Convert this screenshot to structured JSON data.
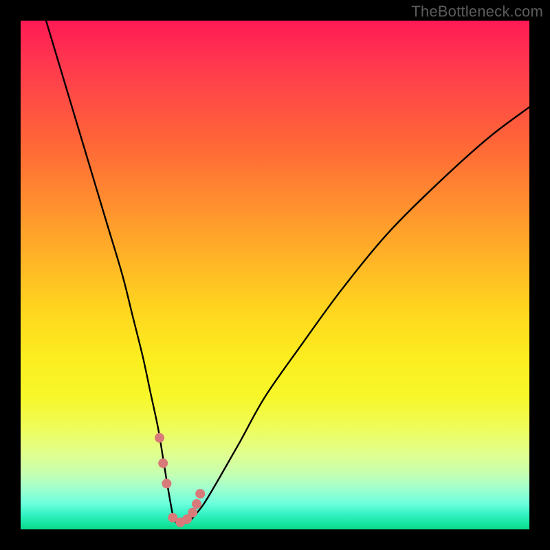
{
  "watermark": "TheBottleneck.com",
  "chart_data": {
    "type": "line",
    "title": "",
    "xlabel": "",
    "ylabel": "",
    "xlim": [
      0,
      100
    ],
    "ylim": [
      0,
      100
    ],
    "curve": {
      "x": [
        5,
        8,
        11,
        14,
        17,
        20,
        22,
        24,
        25.5,
        27,
        28,
        28.8,
        29.5,
        30,
        30.5,
        31,
        32,
        33,
        34,
        36,
        39,
        43,
        48,
        55,
        63,
        72,
        82,
        92,
        100
      ],
      "y": [
        100,
        90,
        80,
        70,
        60,
        50,
        42,
        34,
        27,
        20,
        14,
        9,
        5,
        2.5,
        1.4,
        1.2,
        1.2,
        1.5,
        2.5,
        5,
        10,
        17,
        26,
        36,
        47,
        58,
        68,
        77,
        83
      ]
    },
    "markers": {
      "x": [
        27.3,
        28.0,
        28.7,
        29.9,
        31.4,
        32.7,
        33.8,
        34.6,
        35.3
      ],
      "y": [
        18.0,
        13.0,
        9.0,
        2.3,
        1.4,
        2.0,
        3.3,
        5.0,
        7.0
      ],
      "color": "#d97a7a",
      "radius": 7
    },
    "gradient_stops": [
      {
        "pos": 0.0,
        "color": "#ff1a55"
      },
      {
        "pos": 0.1,
        "color": "#ff3d4d"
      },
      {
        "pos": 0.24,
        "color": "#ff6637"
      },
      {
        "pos": 0.36,
        "color": "#ff8f2f"
      },
      {
        "pos": 0.46,
        "color": "#ffb127"
      },
      {
        "pos": 0.56,
        "color": "#ffd31f"
      },
      {
        "pos": 0.66,
        "color": "#fced1f"
      },
      {
        "pos": 0.74,
        "color": "#f7f72a"
      },
      {
        "pos": 0.8,
        "color": "#effc5a"
      },
      {
        "pos": 0.85,
        "color": "#e1ff8d"
      },
      {
        "pos": 0.89,
        "color": "#c7ffb0"
      },
      {
        "pos": 0.92,
        "color": "#9fffcf"
      },
      {
        "pos": 0.95,
        "color": "#6affdc"
      },
      {
        "pos": 0.97,
        "color": "#34f2c3"
      },
      {
        "pos": 0.99,
        "color": "#14e49e"
      },
      {
        "pos": 1.0,
        "color": "#0dd989"
      }
    ]
  }
}
